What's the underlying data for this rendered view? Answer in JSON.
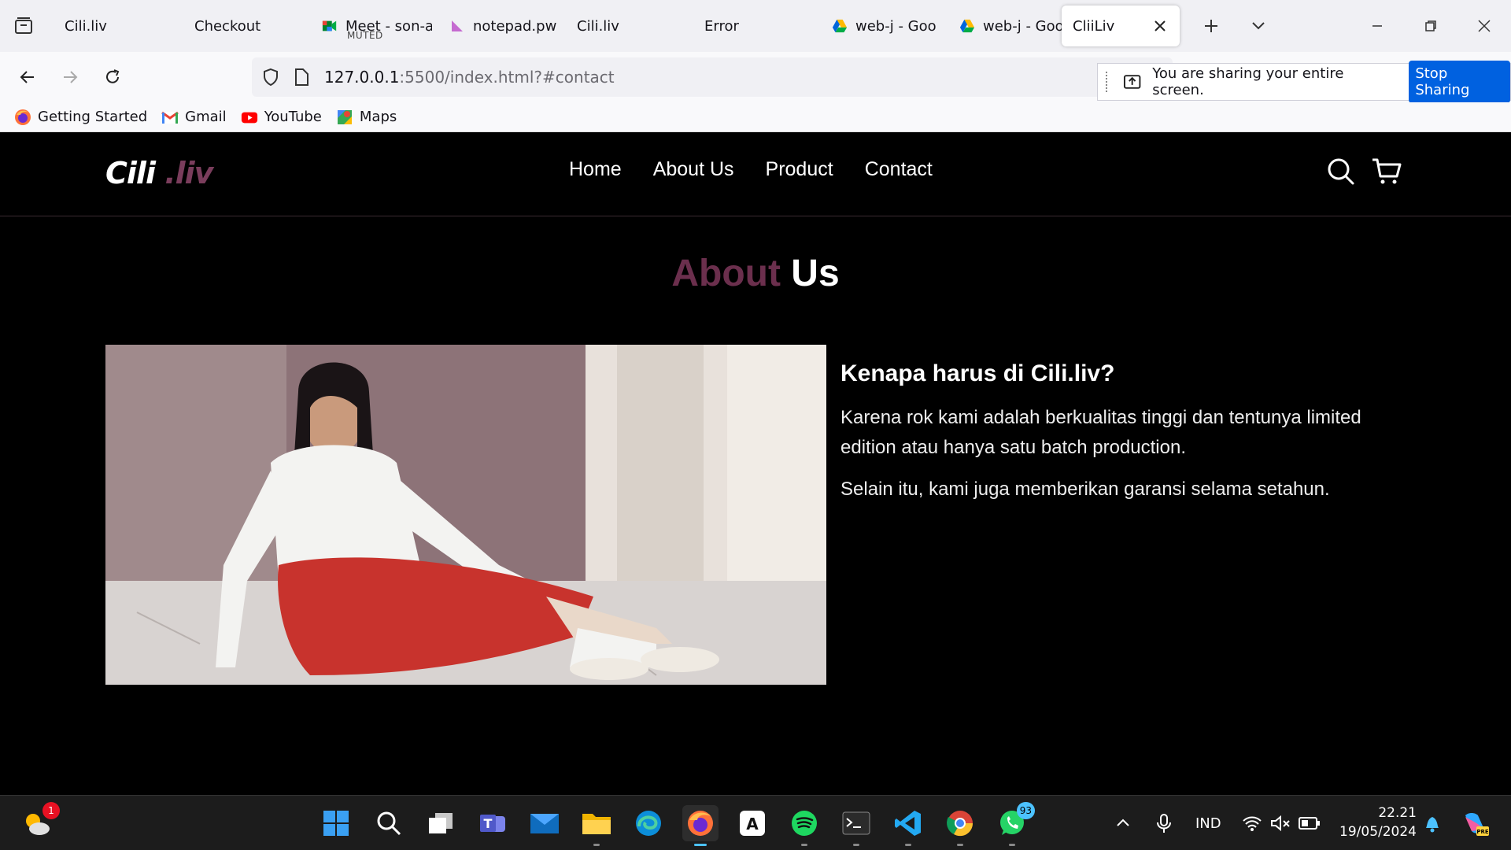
{
  "browser": {
    "tabs": [
      {
        "label": "Cili.liv"
      },
      {
        "label": "Checkout"
      },
      {
        "label": "Meet - son-a",
        "sub": "MUTED"
      },
      {
        "label": "notepad.pw"
      },
      {
        "label": "Cili.liv"
      },
      {
        "label": "Error"
      },
      {
        "label": "web-j - Goo"
      },
      {
        "label": "web-j - Goo"
      },
      {
        "label": "CliiLiv"
      }
    ],
    "url_host": "127.0.0.1",
    "url_rest": ":5500/index.html?#contact",
    "share_message": "You are sharing your entire screen.",
    "stop_sharing_label": "Stop Sharing",
    "bookmarks": [
      {
        "label": "Getting Started",
        "icon": "firefox-icon"
      },
      {
        "label": "Gmail",
        "icon": "gmail-icon"
      },
      {
        "label": "YouTube",
        "icon": "youtube-icon"
      },
      {
        "label": "Maps",
        "icon": "maps-icon"
      }
    ]
  },
  "site": {
    "logo_main": "Cili",
    "logo_accent": " .liv",
    "menu": [
      "Home",
      "About Us",
      "Product",
      "Contact"
    ],
    "section_title_accent": "About",
    "section_title_rest": " Us",
    "heading": "Kenapa harus di Cili.liv?",
    "paragraph1": "Karena rok kami adalah berkualitas tinggi dan tentunya limited edition atau hanya satu batch production.",
    "paragraph2": "Selain itu, kami juga memberikan garansi selama setahun.",
    "colors": {
      "accent": "#6b2f4d",
      "background": "#000000"
    }
  },
  "taskbar": {
    "weather_badge": "1",
    "whatsapp_badge": "93",
    "language": "IND",
    "time": "22.21",
    "date": "19/05/2024"
  }
}
